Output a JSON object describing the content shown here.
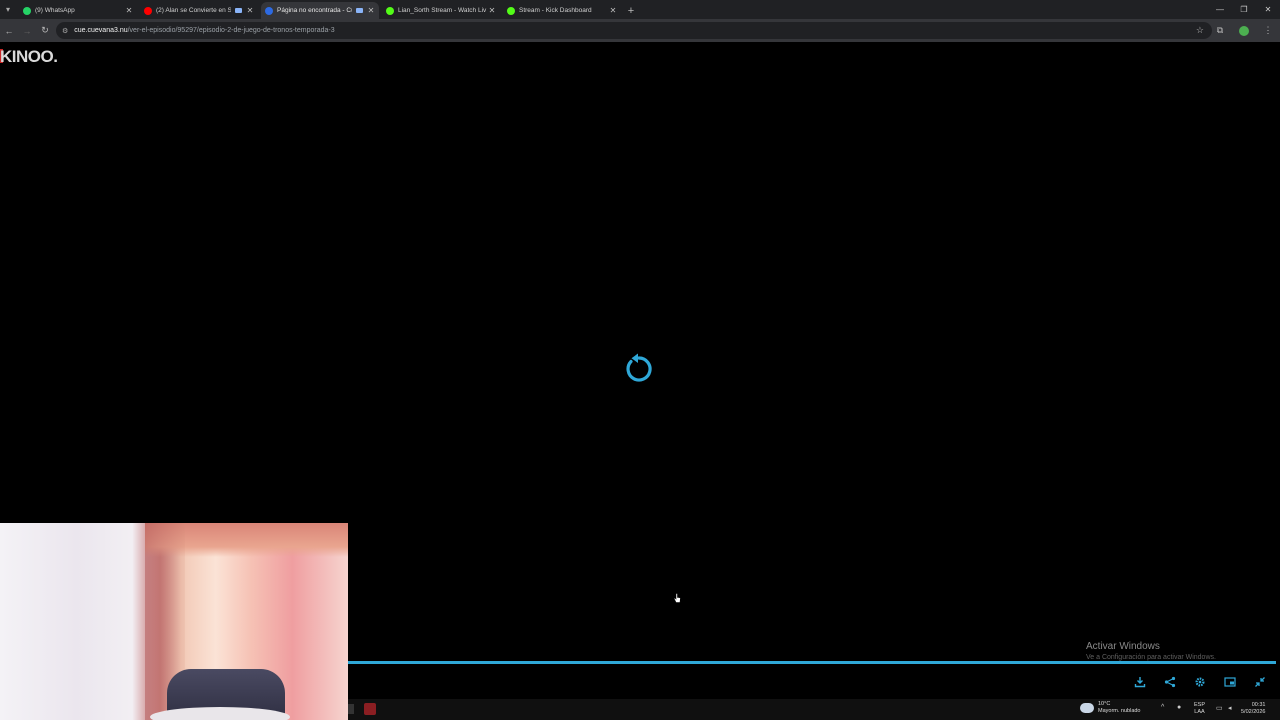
{
  "browser": {
    "tabs": [
      {
        "title": "(9) WhatsApp",
        "favicon": "whatsapp-icon",
        "favicon_color": "#25d366",
        "active": false,
        "media": false
      },
      {
        "title": "(2) Alan se Convierte en SU",
        "favicon": "youtube-icon",
        "favicon_color": "#ff0000",
        "active": false,
        "media": true
      },
      {
        "title": "Página no encontrada - Cu",
        "favicon": "cuevana-icon",
        "favicon_color": "#2d6ae3",
        "active": true,
        "media": true
      },
      {
        "title": "Lian_Sorth Stream - Watch Liv",
        "favicon": "kick-icon",
        "favicon_color": "#53fc18",
        "active": false,
        "media": false
      },
      {
        "title": "Stream - Kick Dashboard",
        "favicon": "kick-icon",
        "favicon_color": "#53fc18",
        "active": false,
        "media": false
      }
    ],
    "url_host": "cue.cuevana3.nu",
    "url_path": "/ver-el-episodio/95297/episodio-2-de-juego-de-tronos-temporada-3"
  },
  "page": {
    "logo_text": "KINOO.",
    "accent_color": "#2fa8d8"
  },
  "player": {
    "progress_fraction": 1.0,
    "controls": [
      "download-icon",
      "share-icon",
      "settings-icon",
      "picture-in-picture-icon",
      "exit-fullscreen-icon"
    ]
  },
  "watermark": {
    "line1": "Activar Windows",
    "line2": "Ve a Configuración para activar Windows."
  },
  "taskbar": {
    "weather_temp": "10°C",
    "weather_desc": "Mayorm. nublado",
    "lang_1": "ESP",
    "lang_2": "LAA",
    "time": "00:31",
    "date": "5/02/2026"
  }
}
